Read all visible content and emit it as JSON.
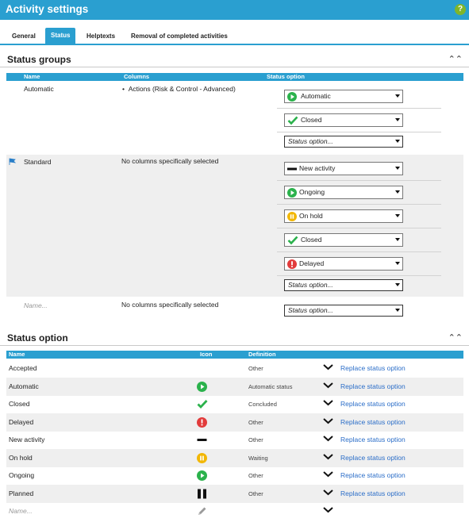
{
  "window": {
    "title": "Activity settings",
    "help": "?"
  },
  "tabs": [
    "General",
    "Status",
    "Helptexts",
    "Removal of completed activities"
  ],
  "status_groups": {
    "title": "Status groups",
    "headers": {
      "name": "Name",
      "columns": "Columns",
      "option": "Status option"
    },
    "automatic": {
      "name": "Automatic",
      "column": "Actions (Risk & Control - Advanced)",
      "options": [
        "Automatic",
        "Closed"
      ],
      "placeholder": "Status option..."
    },
    "standard": {
      "name": "Standard",
      "columns": "No columns specifically selected",
      "options": [
        "New activity",
        "Ongoing",
        "On hold",
        "Closed",
        "Delayed"
      ],
      "placeholder": "Status option..."
    },
    "new": {
      "name_placeholder": "Name...",
      "columns": "No columns specifically selected",
      "placeholder": "Status option..."
    }
  },
  "status_option": {
    "title": "Status option",
    "headers": {
      "name": "Name",
      "icon": "Icon",
      "definition": "Definition"
    },
    "rows": [
      {
        "name": "Accepted",
        "icon": "none",
        "definition": "Other",
        "action": "Replace status option"
      },
      {
        "name": "Automatic",
        "icon": "play-green",
        "definition": "Automatic status",
        "action": "Replace status option"
      },
      {
        "name": "Closed",
        "icon": "check-green",
        "definition": "Concluded",
        "action": "Replace status option"
      },
      {
        "name": "Delayed",
        "icon": "exclamation-red",
        "definition": "Other",
        "action": "Replace status option"
      },
      {
        "name": "New activity",
        "icon": "dash-black",
        "definition": "Other",
        "action": "Replace status option"
      },
      {
        "name": "On hold",
        "icon": "pause-yellow",
        "definition": "Waiting",
        "action": "Replace status option"
      },
      {
        "name": "Ongoing",
        "icon": "play-green",
        "definition": "Other",
        "action": "Replace status option"
      },
      {
        "name": "Planned",
        "icon": "pause-black",
        "definition": "Other",
        "action": "Replace status option"
      }
    ],
    "new_row": {
      "name_placeholder": "Name...",
      "icon": "pencil-gray"
    }
  },
  "colors": {
    "accent": "#2a9fd0",
    "green": "#2bb24c",
    "red": "#e23b3b",
    "yellow": "#f2b705",
    "link": "#2a6dc8",
    "help": "#7fb52a"
  }
}
